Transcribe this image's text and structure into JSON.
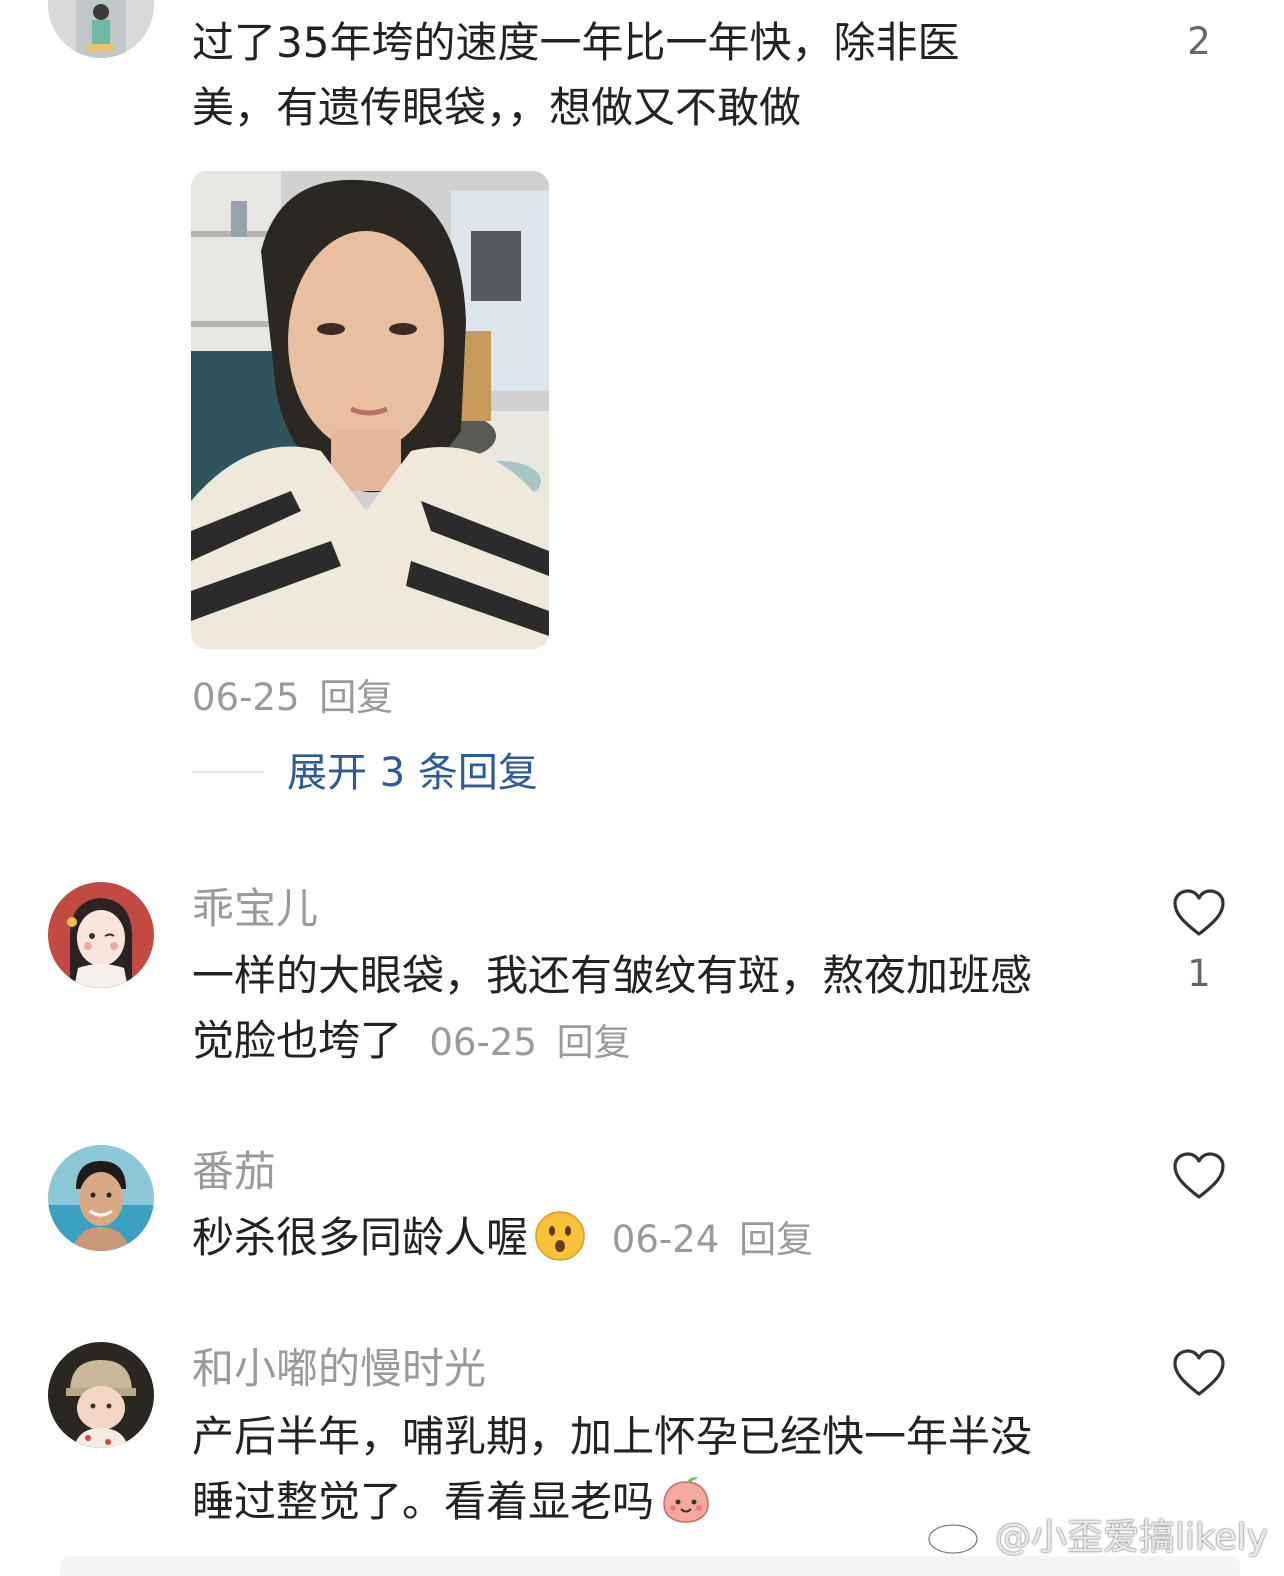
{
  "comment0": {
    "text_line1": "过了35年垮的速度一年比一年快，除非医",
    "text_line2": "美，有遗传眼袋，，想做又不敢做",
    "like_count": "2",
    "date": "06-25",
    "reply_label": "回复",
    "expand_label": "展开 3 条回复"
  },
  "comment1": {
    "username": "乖宝儿",
    "text_line1": "一样的大眼袋，我还有皱纹有斑，熬夜加班感",
    "text_line2": "觉脸也垮了",
    "date": "06-25",
    "reply_label": "回复",
    "like_count": "1"
  },
  "comment2": {
    "username": "番茄",
    "text": "秒杀很多同龄人喔",
    "emoji": "hushed-face-emoji",
    "date": "06-24",
    "reply_label": "回复"
  },
  "comment3": {
    "username": "和小嘟的慢时光",
    "text_line1": "产后半年，哺乳期，加上怀孕已经快一年半没",
    "text_line2": "睡过整觉了。看着显老吗",
    "emoji": "peach-face-emoji"
  },
  "watermark": "@小歪爱搞likely"
}
